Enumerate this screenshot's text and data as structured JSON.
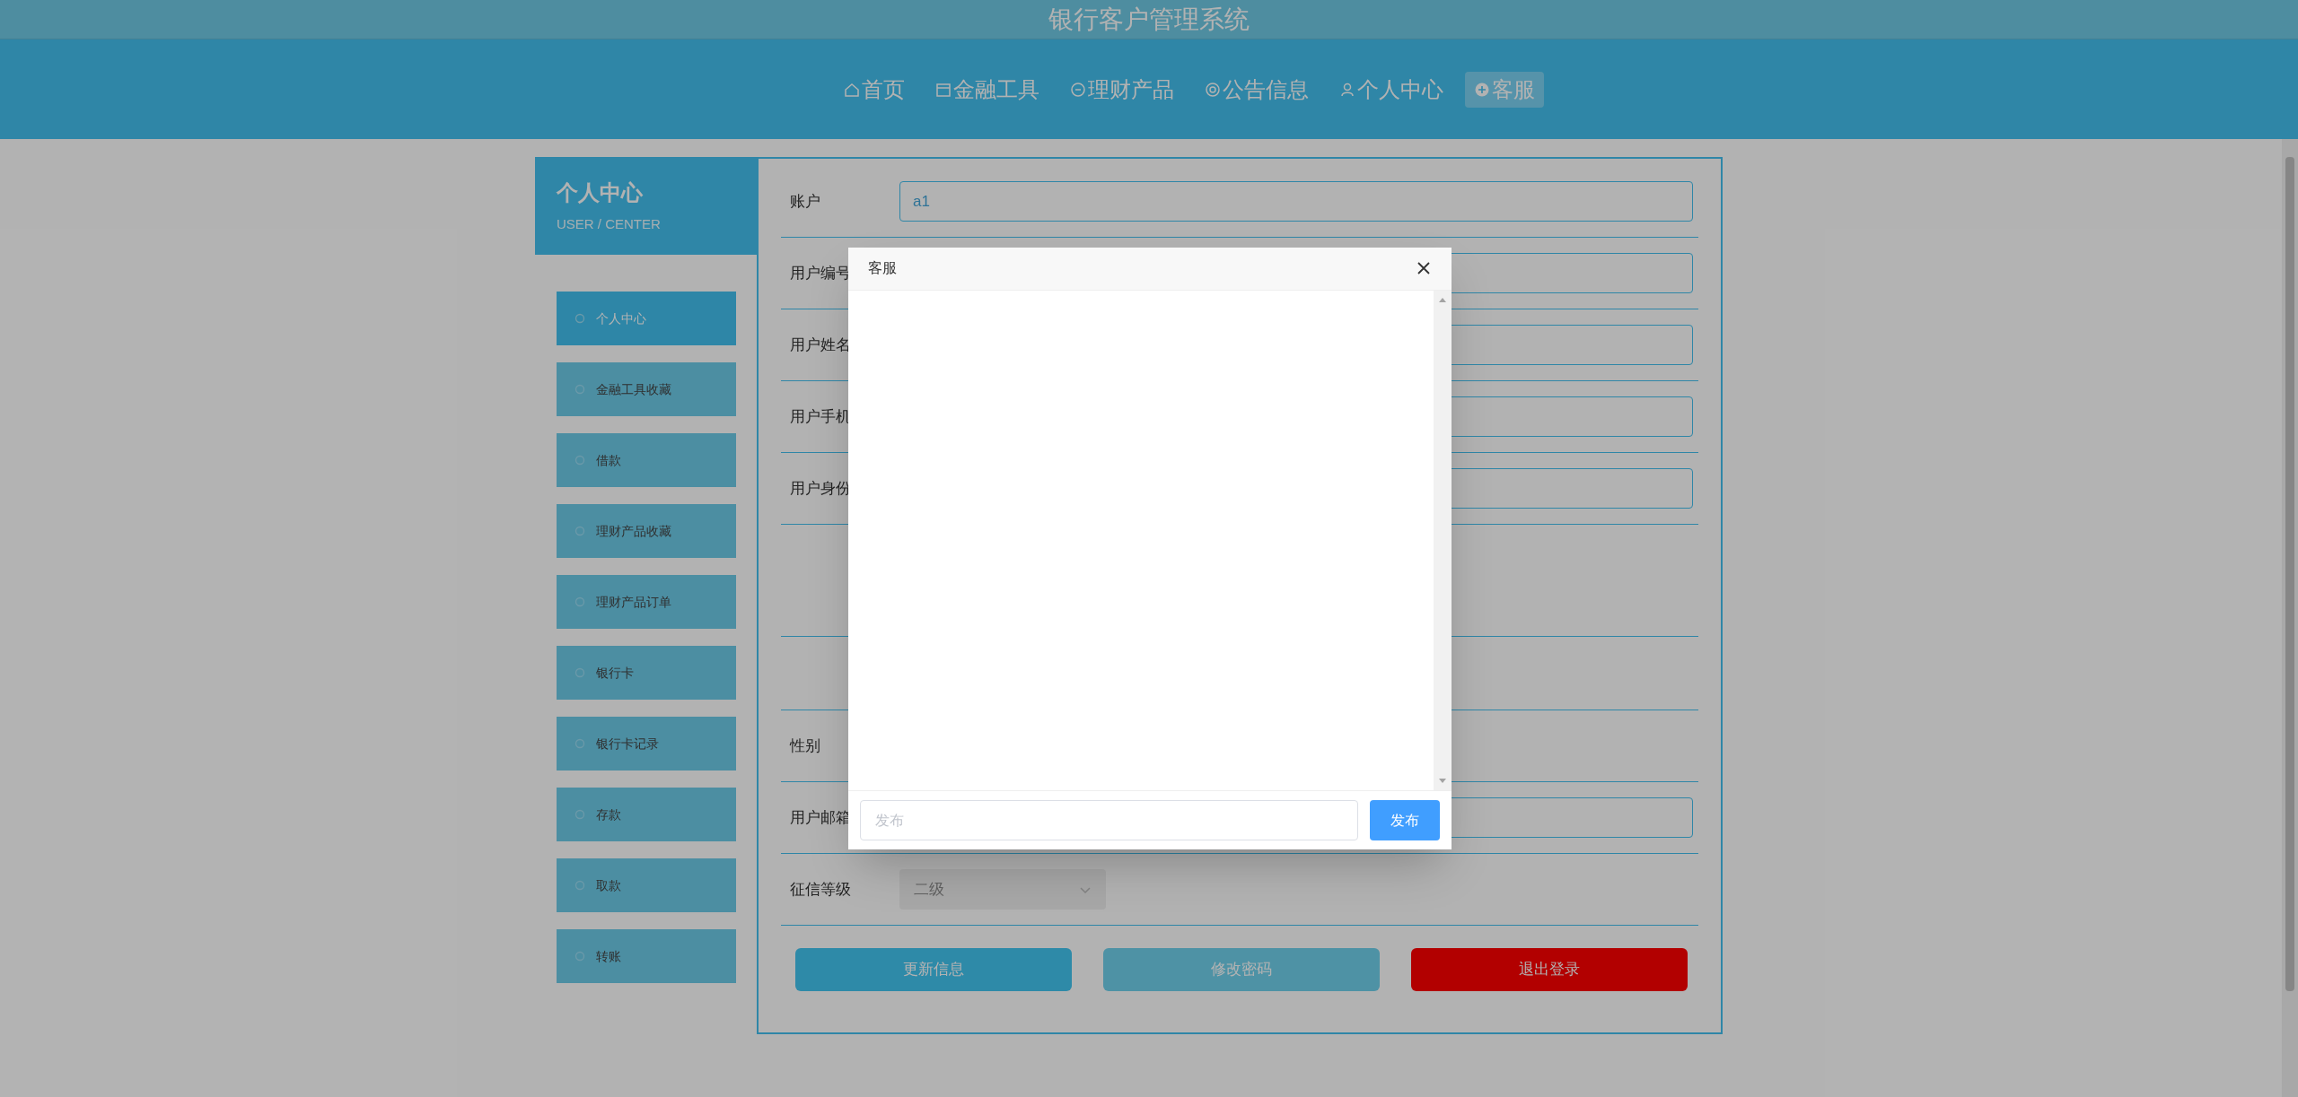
{
  "app_title": "银行客户管理系统",
  "nav": [
    {
      "label": "首页",
      "selected": false
    },
    {
      "label": "金融工具",
      "selected": false
    },
    {
      "label": "理财产品",
      "selected": false
    },
    {
      "label": "公告信息",
      "selected": false
    },
    {
      "label": "个人中心",
      "selected": false
    },
    {
      "label": "客服",
      "selected": true
    }
  ],
  "sidebar": {
    "title": "个人中心",
    "subtitle": "USER / CENTER",
    "items": [
      {
        "label": "个人中心",
        "selected": true
      },
      {
        "label": "金融工具收藏",
        "selected": false
      },
      {
        "label": "借款",
        "selected": false
      },
      {
        "label": "理财产品收藏",
        "selected": false
      },
      {
        "label": "理财产品订单",
        "selected": false
      },
      {
        "label": "银行卡",
        "selected": false
      },
      {
        "label": "银行卡记录",
        "selected": false
      },
      {
        "label": "存款",
        "selected": false
      },
      {
        "label": "取款",
        "selected": false
      },
      {
        "label": "转账",
        "selected": false
      }
    ]
  },
  "form": {
    "fields": [
      {
        "kind": "input",
        "label": "账户",
        "value": "a1"
      },
      {
        "kind": "input",
        "label": "用户编号"
      },
      {
        "kind": "input",
        "label": "用户姓名"
      },
      {
        "kind": "input",
        "label": "用户手机"
      },
      {
        "kind": "input",
        "label": "用户身份"
      },
      {
        "kind": "area"
      },
      {
        "kind": "blank"
      },
      {
        "kind": "plain",
        "label": "性别"
      },
      {
        "kind": "input",
        "label": "用户邮箱"
      },
      {
        "kind": "select",
        "label": "征信等级",
        "value": "二级"
      }
    ],
    "buttons": [
      {
        "kind": "update",
        "label": "更新信息"
      },
      {
        "kind": "password",
        "label": "修改密码"
      },
      {
        "kind": "logout",
        "label": "退出登录"
      }
    ]
  },
  "dialog": {
    "title": "客服",
    "input": {
      "placeholder": "发布"
    },
    "send": "发布"
  }
}
